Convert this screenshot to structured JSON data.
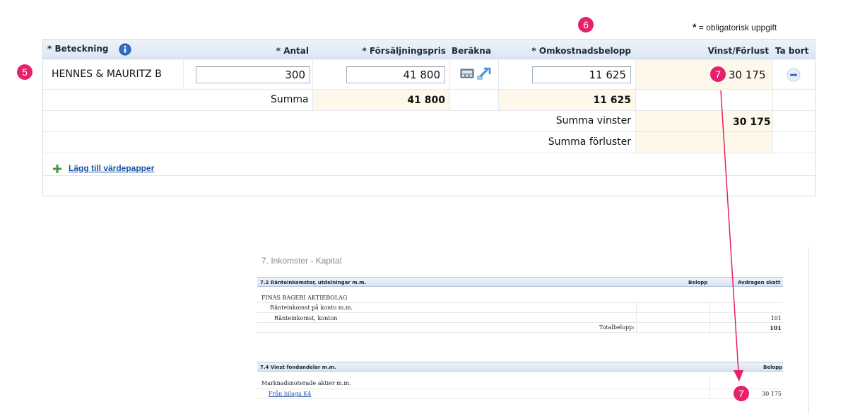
{
  "legend": {
    "star": "*",
    "text": "= obligatorisk uppgift"
  },
  "badges": {
    "b5": "5",
    "b6": "6",
    "b7a": "7",
    "b7b": "7"
  },
  "grid": {
    "headers": {
      "beteckning": "* Beteckning",
      "antal": "* Antal",
      "forsaljningspris": "* Försäljningspris",
      "berakna": "Beräkna",
      "omkostnadsbelopp": "* Omkostnadsbelopp",
      "vinst_forlust": "Vinst/Förlust",
      "ta_bort": "Ta bort"
    },
    "row": {
      "beteckning": "HENNES & MAURITZ B",
      "antal": "300",
      "forsaljningspris": "41 800",
      "omkostnadsbelopp": "11 625",
      "vinst_forlust": "30 175"
    },
    "summa": {
      "label": "Summa",
      "forsaljningspris": "41 800",
      "omkostnadsbelopp": "11 625"
    },
    "summa_vinster": {
      "label": "Summa vinster",
      "value": "30 175"
    },
    "summa_forluster": {
      "label": "Summa förluster",
      "value": ""
    },
    "add_link": "Lägg till värdepapper"
  },
  "report": {
    "title": "7. Inkomster - Kapital",
    "table1": {
      "header": "7.2 Ränteinkomster, utdelningar m.m.",
      "col_belopp": "Belopp",
      "col_skatt": "Avdragen skatt",
      "company": "FINAS BAGERI AKTIEBOLAG",
      "sub1": "Ränteinkomst på konto m.m.",
      "sub2": "Ränteinkomst, konton",
      "sub2_skatt": "101",
      "total_label": "Totalbelopp:",
      "total_skatt": "101"
    },
    "table2": {
      "header": "7.4 Vinst fondandelar m.m.",
      "col_belopp": "Belopp",
      "group": "Marknadsnoterade aktier m.m.",
      "link": "Från bilaga K4",
      "belopp": "30 175"
    }
  },
  "colors": {
    "accent_badge": "#e6206b",
    "link": "#1a54a6",
    "highlight": "#fdf8ea"
  }
}
